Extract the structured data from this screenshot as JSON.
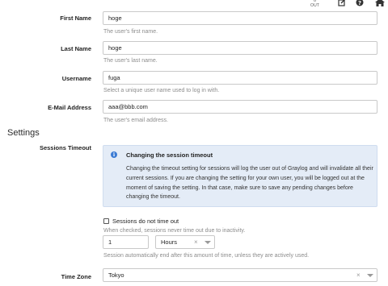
{
  "topbar": {
    "traffic_value": "0",
    "traffic_unit": "OUT",
    "icons": [
      "edit-icon",
      "help-icon",
      "home-icon"
    ]
  },
  "fields": {
    "first_name": {
      "label": "First Name",
      "value": "hoge",
      "help": "The user's first name."
    },
    "last_name": {
      "label": "Last Name",
      "value": "hoge",
      "help": "The user's last name."
    },
    "username": {
      "label": "Username",
      "value": "fuga",
      "help": "Select a unique user name used to log in with."
    },
    "email": {
      "label": "E-Mail Address",
      "value": "aaa@bbb.com",
      "help": "The user's email address."
    }
  },
  "settings": {
    "title": "Settings",
    "sessions_timeout": {
      "label": "Sessions Timeout",
      "alert_title": "Changing the session timeout",
      "alert_body": "Changing the timeout setting for sessions will log the user out of Graylog and will invalidate all their current sessions. If you are changing the setting for your own user, you will be logged out at the moment of saving the setting. In that case, make sure to save any pending changes before changing the timeout.",
      "checkbox_label": "Sessions do not time out",
      "checkbox_checked": false,
      "checkbox_help": "When checked, sessions never time out due to inactivity.",
      "amount_value": "1",
      "unit_value": "Hours",
      "amount_help": "Session automatically end after this amount of time, unless they are actively used."
    },
    "time_zone": {
      "label": "Time Zone",
      "value": "Tokyo"
    }
  },
  "colors": {
    "alert_background": "#e4ecf7",
    "info_icon": "#3b7bd4"
  }
}
